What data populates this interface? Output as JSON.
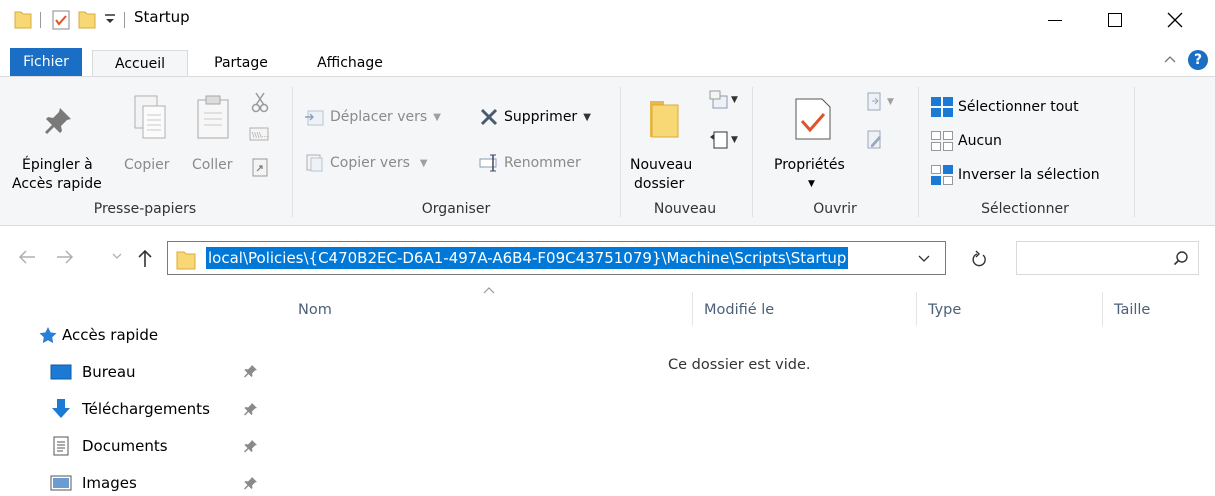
{
  "window": {
    "title": "Startup"
  },
  "tabs": {
    "file": "Fichier",
    "home": "Accueil",
    "share": "Partage",
    "view": "Affichage"
  },
  "ribbon": {
    "pin_line1": "Épingler à",
    "pin_line2": "Accès rapide",
    "copy": "Copier",
    "paste": "Coller",
    "group_clipboard": "Presse-papiers",
    "move_to": "Déplacer vers",
    "copy_to": "Copier vers",
    "delete": "Supprimer",
    "rename": "Renommer",
    "group_organize": "Organiser",
    "new_folder_line1": "Nouveau",
    "new_folder_line2": "dossier",
    "group_new": "Nouveau",
    "properties": "Propriétés",
    "group_open": "Ouvrir",
    "select_all": "Sélectionner tout",
    "select_none": "Aucun",
    "invert_selection": "Inverser la sélection",
    "group_select": "Sélectionner"
  },
  "address": {
    "path": "local\\Policies\\{C470B2EC-D6A1-497A-A6B4-F09C43751079}\\Machine\\Scripts\\Startup"
  },
  "columns": {
    "name": "Nom",
    "modified": "Modifié le",
    "type": "Type",
    "size": "Taille"
  },
  "content": {
    "empty_message": "Ce dossier est vide."
  },
  "nav": {
    "quick_access": "Accès rapide",
    "items": [
      {
        "label": "Bureau"
      },
      {
        "label": "Téléchargements"
      },
      {
        "label": "Documents"
      },
      {
        "label": "Images"
      }
    ]
  },
  "colors": {
    "file_tab": "#1a6fc4",
    "selection": "#0078d7",
    "folder": "#f8d775"
  }
}
